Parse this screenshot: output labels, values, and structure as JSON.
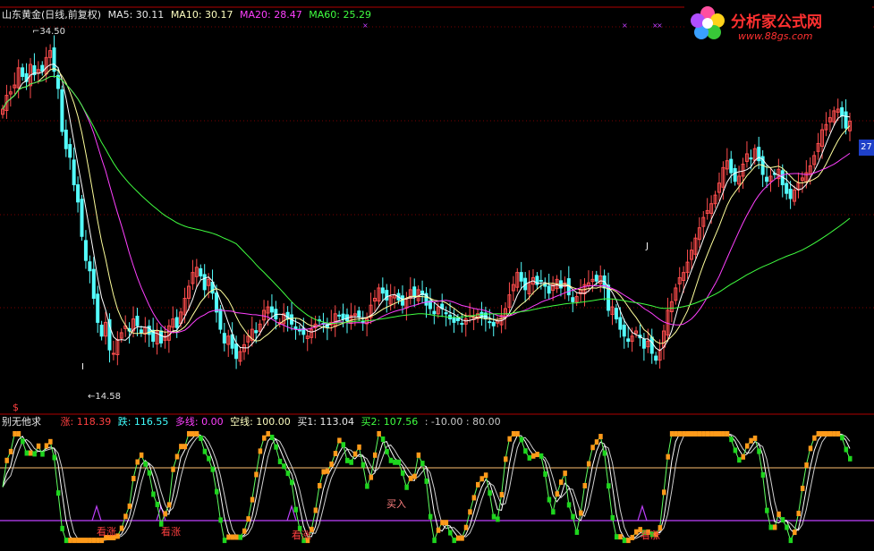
{
  "main_header": {
    "title": "山东黄金(日线,前复权)",
    "ma5": "MA5: 30.11",
    "ma10": "MA10: 30.17",
    "ma20": "MA20: 28.47",
    "ma60": "MA60: 25.29"
  },
  "sub_header": {
    "name": "别无他求",
    "rise": "涨: 118.39",
    "fall": "跌: 116.55",
    "long_line": "多线: 0.00",
    "short_line": "空线: 100.00",
    "buy1": "买1: 113.04",
    "buy2": "买2: 107.56",
    "levels": ": -10.00 : 80.00"
  },
  "annotations": {
    "high": "34.50",
    "low": "14.58",
    "price_tag": "27",
    "marker_dollar": "$",
    "marker_i": "I",
    "marker_j": "J"
  },
  "indicator_labels": {
    "l1": "看涨",
    "l2": "看涨",
    "l3": "看涨",
    "l4": "买入",
    "l5": "看涨"
  },
  "logo": {
    "name": "分析家公式网",
    "url": "www.88gs.com"
  },
  "colors": {
    "up": "#ff4d4d",
    "down": "#54ffff",
    "ma5": "#ffffff",
    "ma10": "#ffff9c",
    "ma20": "#ff40ff",
    "ma60": "#40ff40",
    "indicator_orange": "#ff9a1a",
    "indicator_green": "#1ed61e"
  },
  "chart_data": {
    "type": "candlestick",
    "title": "山东黄金(日线,前复权)",
    "ylim": [
      14.0,
      36.0
    ],
    "close": [
      30.8,
      31.6,
      31.8,
      32.2,
      33.2,
      32.7,
      32.4,
      33.4,
      32.8,
      33.1,
      33.0,
      33.8,
      34.2,
      33.0,
      32.0,
      29.5,
      28.5,
      28.0,
      26.4,
      25.4,
      23.4,
      22.0,
      21.4,
      19.8,
      18.4,
      17.6,
      18.4,
      16.8,
      16.6,
      17.4,
      17.8,
      18.2,
      17.9,
      18.6,
      18.2,
      17.8,
      18.1,
      17.7,
      17.3,
      17.9,
      17.2,
      17.6,
      18.2,
      18.6,
      18.1,
      19.0,
      19.8,
      20.5,
      21.3,
      21.6,
      21.1,
      20.3,
      20.9,
      20.1,
      19.0,
      18.0,
      17.2,
      17.6,
      16.9,
      16.3,
      16.7,
      17.1,
      17.6,
      18.0,
      17.8,
      18.3,
      19.1,
      19.3,
      19.0,
      18.6,
      18.4,
      18.9,
      18.6,
      18.3,
      18.0,
      17.9,
      17.7,
      17.6,
      18.0,
      18.3,
      18.5,
      18.3,
      18.1,
      18.4,
      18.9,
      18.8,
      18.6,
      18.5,
      18.8,
      18.9,
      18.7,
      18.4,
      18.6,
      19.4,
      19.8,
      20.4,
      20.1,
      19.7,
      19.9,
      20.0,
      19.7,
      19.4,
      19.8,
      20.3,
      19.9,
      20.3,
      20.0,
      19.4,
      19.2,
      18.9,
      19.3,
      19.2,
      18.9,
      18.6,
      18.4,
      18.5,
      18.3,
      18.6,
      18.8,
      18.7,
      18.9,
      18.7,
      18.6,
      18.4,
      18.2,
      18.5,
      18.8,
      19.2,
      20.0,
      20.6,
      21.3,
      20.8,
      20.3,
      20.7,
      21.0,
      20.6,
      20.8,
      20.5,
      20.1,
      20.6,
      20.9,
      20.4,
      20.7,
      20.0,
      19.6,
      19.9,
      20.3,
      20.6,
      20.7,
      20.9,
      20.8,
      21.1,
      20.4,
      19.1,
      19.3,
      18.6,
      18.0,
      17.6,
      17.3,
      17.6,
      17.9,
      17.5,
      16.9,
      17.3,
      16.6,
      16.2,
      16.8,
      17.9,
      19.1,
      19.6,
      20.4,
      21.0,
      21.3,
      21.9,
      22.6,
      23.3,
      23.9,
      24.5,
      24.9,
      25.3,
      25.8,
      26.5,
      27.4,
      27.8,
      27.1,
      26.6,
      26.9,
      27.6,
      28.2,
      27.9,
      28.5,
      27.8,
      27.0,
      26.6,
      26.9,
      27.0,
      27.3,
      26.4,
      25.9,
      25.6,
      26.1,
      26.5,
      26.8,
      27.1,
      27.5,
      28.1,
      28.8,
      29.6,
      29.9,
      30.3,
      30.7,
      30.8,
      30.4,
      29.7,
      30.1
    ],
    "ma_values": {
      "MA5": 30.11,
      "MA10": 30.17,
      "MA20": 28.47,
      "MA60": 25.29
    },
    "indicator": {
      "name": "别无他求",
      "values": {
        "涨": 118.39,
        "跌": 116.55,
        "多线": 0.0,
        "空线": 100.0,
        "买1": 113.04,
        "买2": 107.56
      },
      "levels": [
        -10.0,
        80.0
      ]
    }
  }
}
